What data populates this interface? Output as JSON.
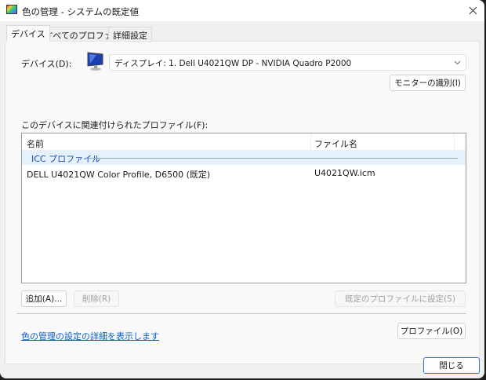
{
  "window": {
    "title": "色の管理 - システムの既定値"
  },
  "tabs": [
    {
      "label": "デバイス"
    },
    {
      "label": "すべてのプロファイル"
    },
    {
      "label": "詳細設定"
    }
  ],
  "device": {
    "label": "デバイス(D):",
    "selected": "ディスプレイ: 1. Dell U4021QW DP - NVIDIA Quadro P2000",
    "identify_button": "モニターの識別(I)"
  },
  "profiles": {
    "label": "このデバイスに関連付けられたプロファイル(F):",
    "columns": [
      "名前",
      "ファイル名"
    ],
    "group": "ICC プロファイル",
    "rows": [
      {
        "name": "DELL U4021QW Color Profile, D6500 (既定)",
        "file": "U4021QW.icm"
      }
    ]
  },
  "buttons": {
    "add": "追加(A)...",
    "remove": "削除(R)",
    "set_default": "既定のプロファイルに設定(S)",
    "profile": "プロファイル(O)",
    "close": "閉じる"
  },
  "link": "色の管理の設定の詳細を表示します"
}
